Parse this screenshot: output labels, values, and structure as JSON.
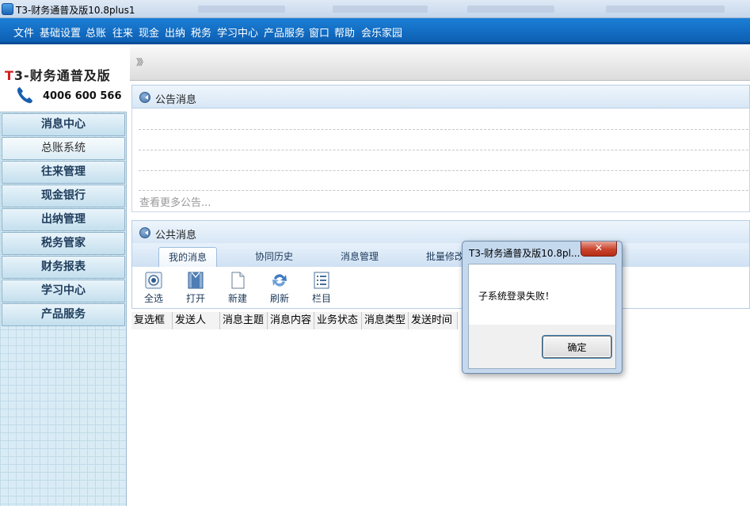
{
  "window": {
    "title": "T3-财务通普及版10.8plus1"
  },
  "menubar": {
    "items": [
      "文件",
      "基础设置",
      "总账",
      "往来",
      "现金",
      "出纳",
      "税务",
      "学习中心",
      "产品服务",
      "窗口",
      "帮助",
      "会乐家园"
    ]
  },
  "sidebar": {
    "brand_prefix": "T",
    "brand_rest": "3-财务通普及版",
    "phone": "4006 600 566",
    "items": [
      "消息中心",
      "总账系统",
      "往来管理",
      "现金银行",
      "出纳管理",
      "税务管家",
      "财务报表",
      "学习中心",
      "产品服务"
    ],
    "active_index": 1
  },
  "breadcrumb": {
    "chevron": "》》"
  },
  "notice_panel": {
    "title": "公告消息",
    "more_link": "查看更多公告..."
  },
  "public_panel": {
    "title": "公共消息",
    "tabs": [
      "我的消息",
      "协同历史",
      "消息管理",
      "批量修改"
    ],
    "toolbar": [
      "全选",
      "打开",
      "新建",
      "刷新",
      "栏目"
    ],
    "columns": [
      "复选框",
      "发送人",
      "消息主题",
      "消息内容",
      "业务状态",
      "消息类型",
      "发送时间"
    ]
  },
  "dialog": {
    "title": "T3-财务通普及版10.8pl...",
    "message": "子系统登录失败！",
    "ok_label": "确定",
    "close_glyph": "✕"
  },
  "colors": {
    "menubar": "#0d5fb3",
    "sidebar": "#d9ecf5",
    "brand_red": "#d31d1d",
    "close_red": "#c9432c"
  }
}
